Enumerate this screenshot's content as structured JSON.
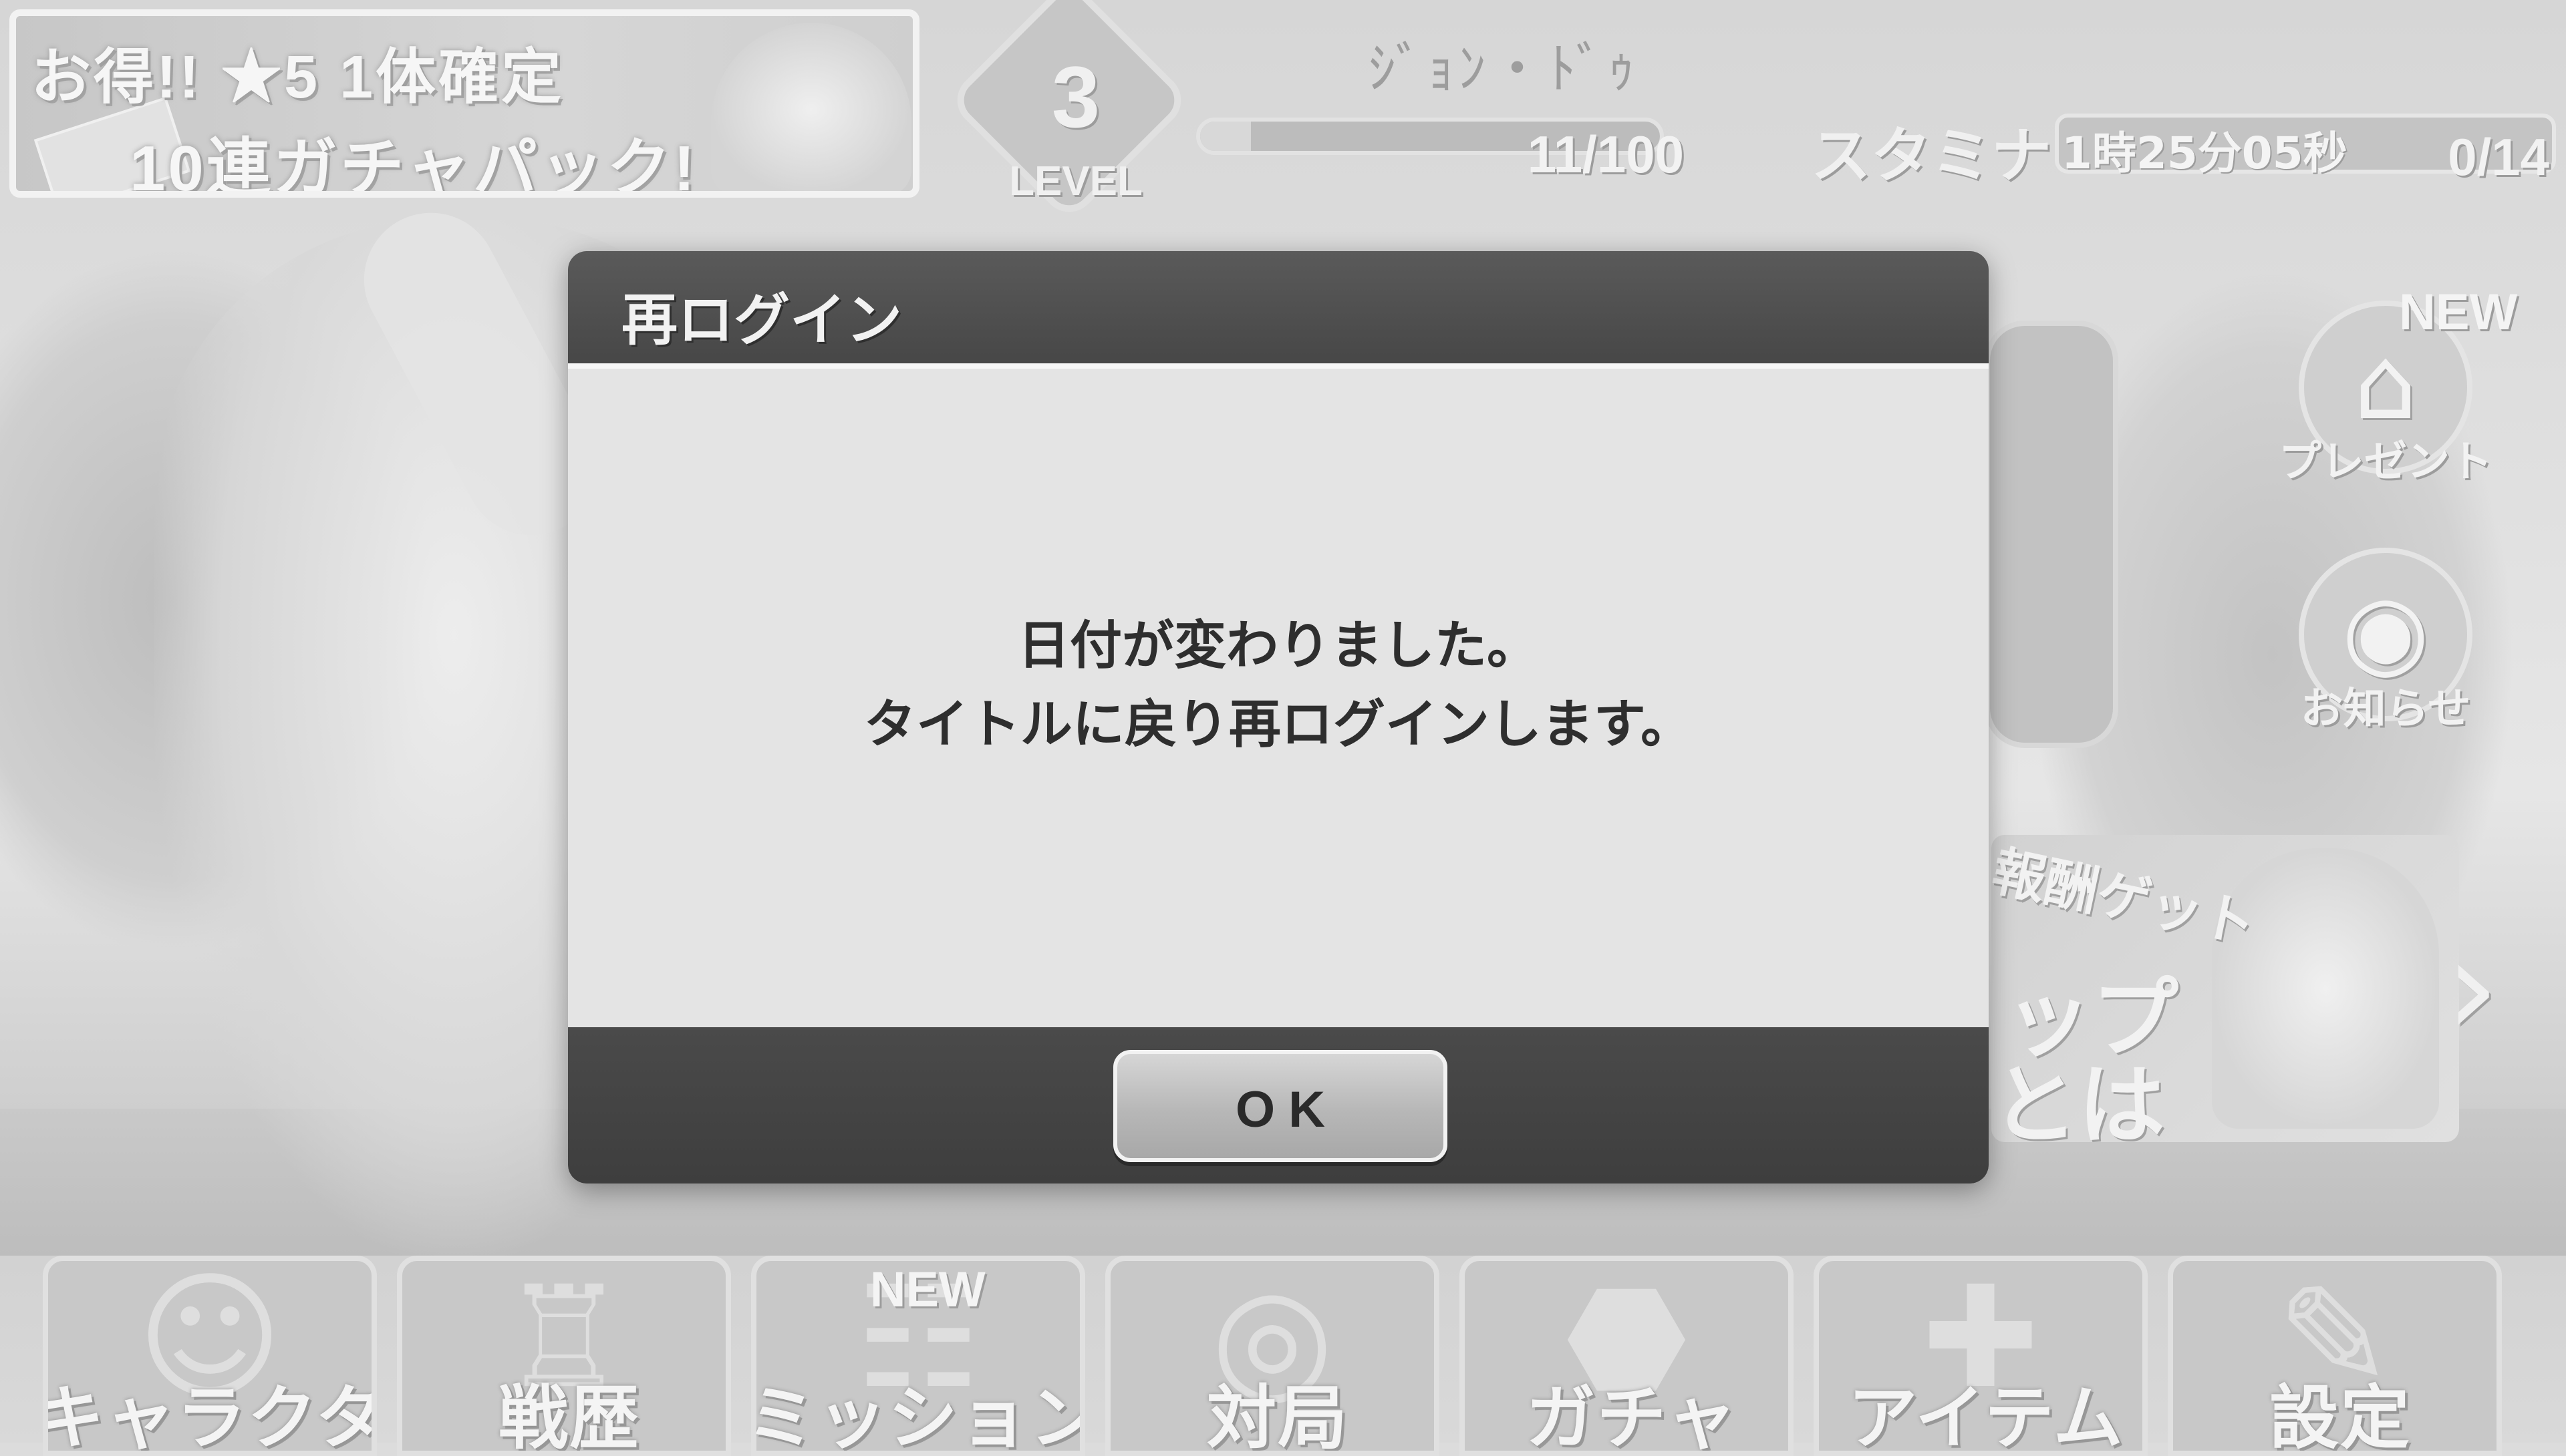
{
  "header": {
    "promo_banner": {
      "line1": "お得!! ★5 1体確定",
      "line2": "10連ガチャパック!"
    },
    "level": {
      "number": "3",
      "label": "LEVEL"
    },
    "player_name": "ｼﾞｮﾝ・ﾄﾞｩ",
    "experience": {
      "text": "11/100",
      "current": 11,
      "max": 100
    },
    "stamina": {
      "label": "スタミナ",
      "timer": "1時25分05秒",
      "count": "0/14"
    }
  },
  "side_menu": {
    "present": {
      "label": "プレゼント",
      "badge": "NEW",
      "icon": "gift-box-icon"
    },
    "news": {
      "label": "お知らせ",
      "icon": "news-icon"
    }
  },
  "event_banner": {
    "text1": "報酬ゲット",
    "text2": "ップ",
    "text3": "とは",
    "arrow": "›"
  },
  "bottom_nav": [
    {
      "label": "キャラクター",
      "icon": "character-icon",
      "glyph": "☺",
      "badge": ""
    },
    {
      "label": "戦歴",
      "icon": "history-cup-icon",
      "glyph": "♖",
      "badge": ""
    },
    {
      "label": "ミッション",
      "icon": "mission-clipboard-icon",
      "glyph": "☷",
      "badge": "NEW"
    },
    {
      "label": "対局",
      "icon": "battle-board-icon",
      "glyph": "◎",
      "badge": ""
    },
    {
      "label": "ガチャ",
      "icon": "gacha-capsule-icon",
      "glyph": "⬣",
      "badge": ""
    },
    {
      "label": "アイテム",
      "icon": "item-bottle-icon",
      "glyph": "✚",
      "badge": ""
    },
    {
      "label": "設定",
      "icon": "settings-wrench-icon",
      "glyph": "✎",
      "badge": ""
    }
  ],
  "dialog": {
    "title": "再ログイン",
    "message_line1": "日付が変わりました。",
    "message_line2": "タイトルに戻り再ログインします。",
    "ok_label": "OK"
  },
  "colors": {
    "dialog_header": "#474747",
    "dialog_body": "#e4e4e4",
    "dialog_footer": "#3e3e3e",
    "ok_button": "#b7b7b7"
  }
}
